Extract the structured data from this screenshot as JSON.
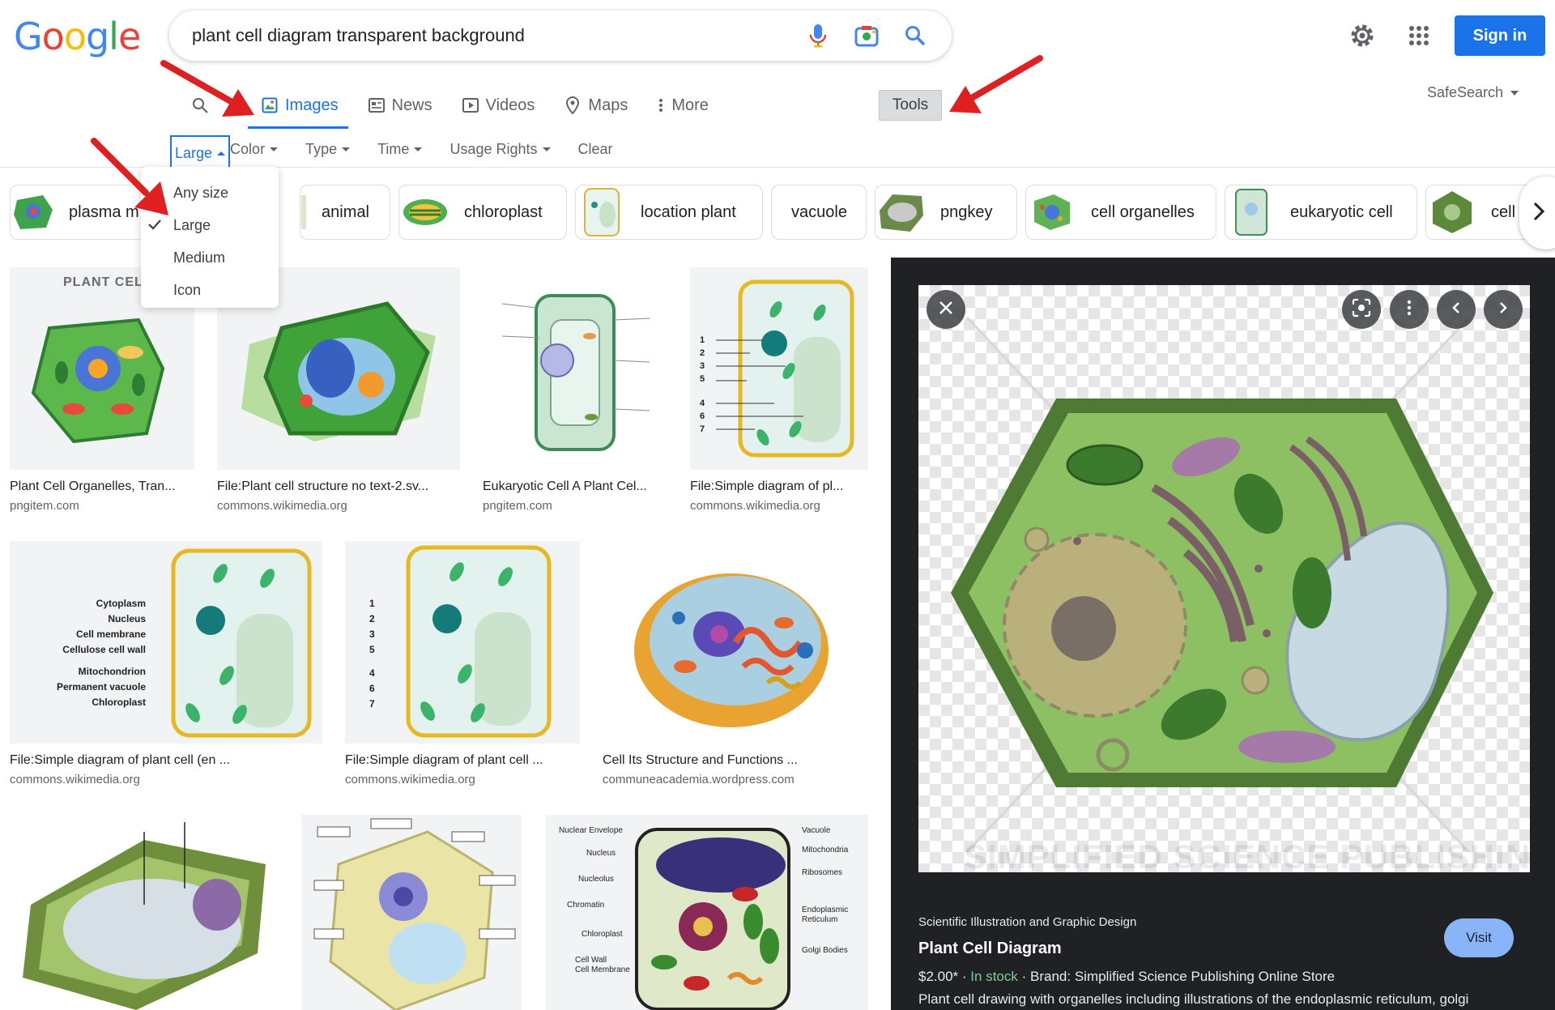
{
  "logo": {
    "letters": [
      "G",
      "o",
      "o",
      "g",
      "l",
      "e"
    ],
    "colors": [
      "#4285f4",
      "#ea4335",
      "#fbbc05",
      "#4285f4",
      "#34a853",
      "#ea4335"
    ]
  },
  "search": {
    "query": "plant cell diagram transparent background"
  },
  "header": {
    "signin_label": "Sign in",
    "safesearch_label": "SafeSearch"
  },
  "tabs": [
    {
      "label": "Images",
      "icon": "image-icon",
      "active": true
    },
    {
      "label": "News",
      "icon": "news-icon"
    },
    {
      "label": "Videos",
      "icon": "video-icon"
    },
    {
      "label": "Maps",
      "icon": "map-pin-icon"
    },
    {
      "label": "More",
      "icon": "more-vert-icon"
    }
  ],
  "tools_label": "Tools",
  "filters": {
    "size": "Large",
    "color": "Color",
    "type": "Type",
    "time": "Time",
    "usage": "Usage Rights",
    "clear": "Clear"
  },
  "size_menu": {
    "options": [
      "Any size",
      "Large",
      "Medium",
      "Icon"
    ],
    "selected": "Large"
  },
  "chips": [
    "plasma m",
    "animal",
    "chloroplast",
    "location plant",
    "vacuole",
    "pngkey",
    "cell organelles",
    "eukaryotic cell",
    "cell w"
  ],
  "results": [
    {
      "title": "Plant Cell Organelles, Tran...",
      "source": "pngitem.com",
      "img_label": "PLANT CELL"
    },
    {
      "title": "File:Plant cell structure no text-2.sv...",
      "source": "commons.wikimedia.org"
    },
    {
      "title": "Eukaryotic Cell A Plant Cel...",
      "source": "pngitem.com"
    },
    {
      "title": "File:Simple diagram of pl...",
      "source": "commons.wikimedia.org",
      "img_numbers": [
        "1",
        "2",
        "3",
        "5",
        "4",
        "6",
        "7"
      ]
    },
    {
      "title": "File:Simple diagram of plant cell (en ...",
      "source": "commons.wikimedia.org",
      "img_labels": [
        "Cytoplasm",
        "Nucleus",
        "Cell membrane",
        "Cellulose cell wall",
        "Mitochondrion",
        "Permanent vacuole",
        "Chloroplast"
      ]
    },
    {
      "title": "File:Simple diagram of plant cell ...",
      "source": "commons.wikimedia.org",
      "img_numbers": [
        "1",
        "2",
        "3",
        "5",
        "4",
        "6",
        "7"
      ]
    },
    {
      "title": "Cell Its Structure and Functions ...",
      "source": "communeacademia.wordpress.com"
    },
    {
      "title": "",
      "source": ""
    },
    {
      "title": "",
      "source": ""
    },
    {
      "title": "",
      "source": "",
      "img_labels": [
        "Nuclear Envelope",
        "Nucleus",
        "Nucleolus",
        "Chromatin",
        "Chloroplast",
        "Cell Wall",
        "Cell Membrane",
        "Vacuole",
        "Mitochondria",
        "Ribosomes",
        "Endoplasmic Reticulum",
        "Golgi Bodies"
      ]
    }
  ],
  "preview": {
    "site": "Scientific Illustration and Graphic Design",
    "title": "Plant Cell Diagram",
    "price": "$2.00*",
    "stock": "In stock",
    "brand": "Brand: Simplified Science Publishing Online Store",
    "description": "Plant cell drawing with organelles including illustrations of the endoplasmic reticulum, golgi",
    "visit_label": "Visit",
    "watermark": "SIMPLIFIED SCIENCE PUBLISHING"
  },
  "colors": {
    "accent": "#1a73e8",
    "annotation_arrow": "#e02020",
    "panel_bg": "#202124"
  }
}
